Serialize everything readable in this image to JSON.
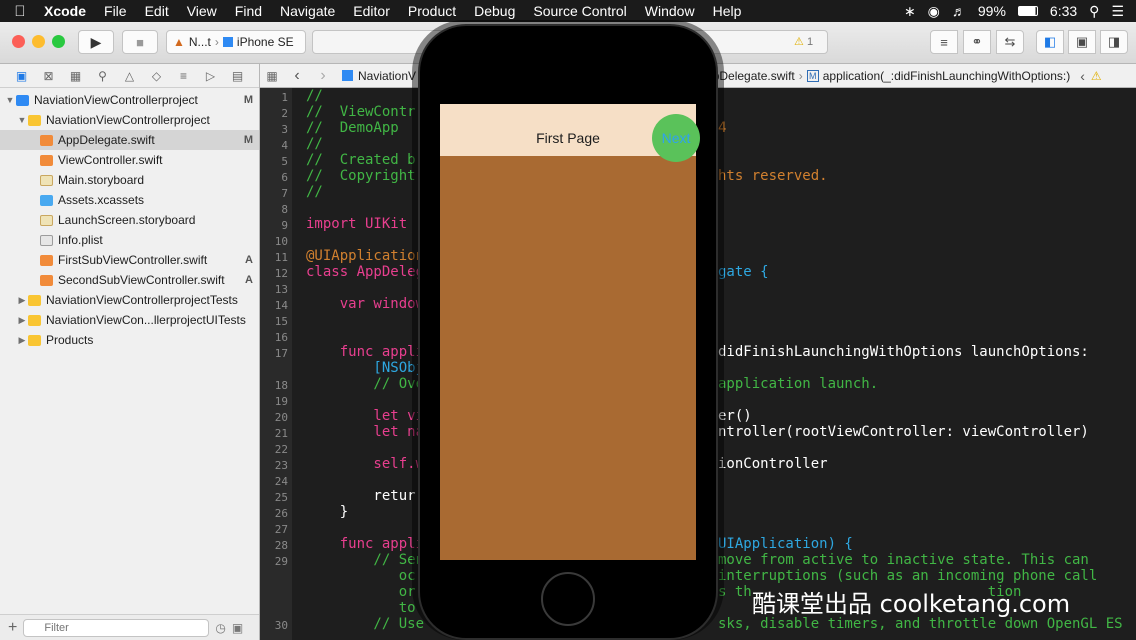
{
  "menubar": {
    "items": [
      "Xcode",
      "File",
      "Edit",
      "View",
      "Find",
      "Navigate",
      "Editor",
      "Product",
      "Debug",
      "Source Control",
      "Window",
      "Help"
    ],
    "battery": "99%",
    "time": "6:33"
  },
  "toolbar": {
    "scheme": "N...t",
    "device": "iPhone SE",
    "warning_count": "1"
  },
  "navigator": {
    "filter_placeholder": "Filter",
    "rows": [
      {
        "label": "NaviationViewControllerproject",
        "status": "M",
        "depth": 0
      },
      {
        "label": "NaviationViewControllerproject",
        "status": "",
        "depth": 1
      },
      {
        "label": "AppDelegate.swift",
        "status": "M",
        "depth": 2
      },
      {
        "label": "ViewController.swift",
        "status": "",
        "depth": 2
      },
      {
        "label": "Main.storyboard",
        "status": "",
        "depth": 2
      },
      {
        "label": "Assets.xcassets",
        "status": "",
        "depth": 2
      },
      {
        "label": "LaunchScreen.storyboard",
        "status": "",
        "depth": 2
      },
      {
        "label": "Info.plist",
        "status": "",
        "depth": 2
      },
      {
        "label": "FirstSubViewController.swift",
        "status": "A",
        "depth": 2
      },
      {
        "label": "SecondSubViewController.swift",
        "status": "A",
        "depth": 2
      },
      {
        "label": "NaviationViewControllerprojectTests",
        "status": "",
        "depth": 1
      },
      {
        "label": "NaviationViewCon...llerprojectUITests",
        "status": "",
        "depth": 1
      },
      {
        "label": "Products",
        "status": "",
        "depth": 1
      }
    ]
  },
  "jumpbar": {
    "project": "NaviationV",
    "file": "ppDelegate.swift",
    "symbol": "application(_:didFinishLaunchingWithOptions:)"
  },
  "editor": {
    "line_numbers": [
      "1",
      "2",
      "3",
      "4",
      "5",
      "6",
      "7",
      "8",
      "9",
      "10",
      "11",
      "12",
      "13",
      "14",
      "15",
      "16",
      "17",
      "",
      "18",
      "19",
      "20",
      "21",
      "22",
      "23",
      "24",
      "25",
      "26",
      "27",
      "28",
      "29",
      "",
      "",
      "",
      "30"
    ],
    "left_code": [
      "//",
      "//  ViewContr",
      "//  DemoApp",
      "//",
      "//  Created b",
      "//  Copyright",
      "//",
      "",
      "import UIKit",
      "",
      "@UIApplication",
      "class AppDeleg",
      "",
      "    var window",
      "",
      "",
      "    func appli",
      "        [NSObj",
      "        // Ove",
      "",
      "        let vi",
      "        let na",
      "",
      "        self.w",
      "",
      "        retur",
      "    }",
      "",
      "    func appli",
      "        // Sen",
      "           oc",
      "           or",
      "           to",
      "        // Use"
    ],
    "right_code": [
      "",
      "",
      "4",
      "",
      "",
      "hts reserved.",
      "",
      "",
      "",
      "",
      "",
      "gate {",
      "",
      "",
      "",
      "",
      "didFinishLaunchingWithOptions launchOptions:",
      "",
      "application launch.",
      "",
      "er()",
      "ntroller(rootViewController: viewController)",
      "",
      "ionController",
      "",
      "",
      "",
      "",
      "UIApplication) {",
      "move from active to inactive state. This can",
      "interruptions (such as an incoming phone call",
      "s th                            tion",
      "",
      "sks, disable timers, and throttle down OpenGL ES"
    ]
  },
  "simulator": {
    "nav_title": "First Page",
    "next_label": "Next"
  },
  "watermark": "酷课堂出品 coolketang.com"
}
